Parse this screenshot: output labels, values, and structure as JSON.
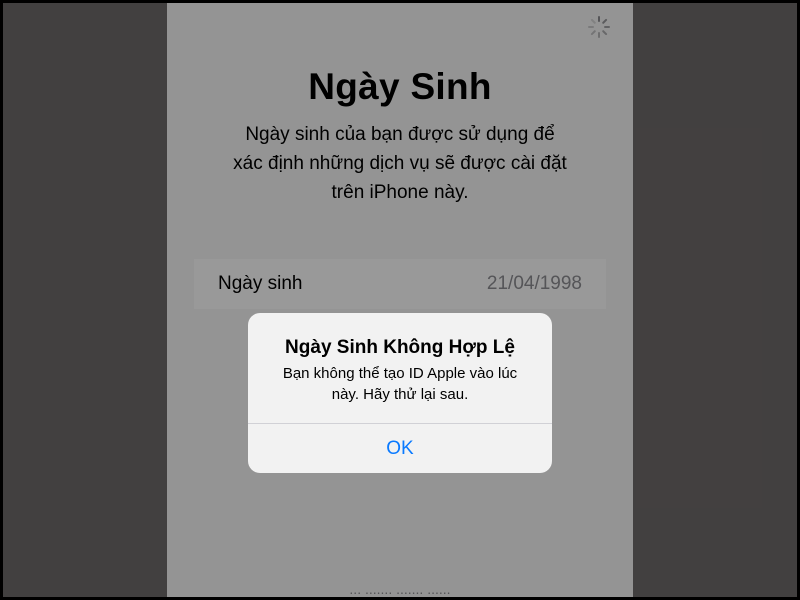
{
  "screen": {
    "title": "Ngày Sinh",
    "description": "Ngày sinh của bạn được sử dụng để xác định những dịch vụ sẽ được cài đặt trên iPhone này.",
    "spinner_icon": "loading-spinner-icon"
  },
  "birthday_row": {
    "label": "Ngày sinh",
    "value": "21/04/1998"
  },
  "footer": {
    "text": "... ....... ....... ......"
  },
  "alert": {
    "title": "Ngày Sinh Không Hợp Lệ",
    "message": "Bạn không thể tạo ID Apple vào lúc này. Hãy thử lại sau.",
    "ok_label": "OK"
  },
  "colors": {
    "accent": "#0a7aff",
    "outer_background": "#6f6b6b",
    "secondary_text": "#8e8e93"
  }
}
